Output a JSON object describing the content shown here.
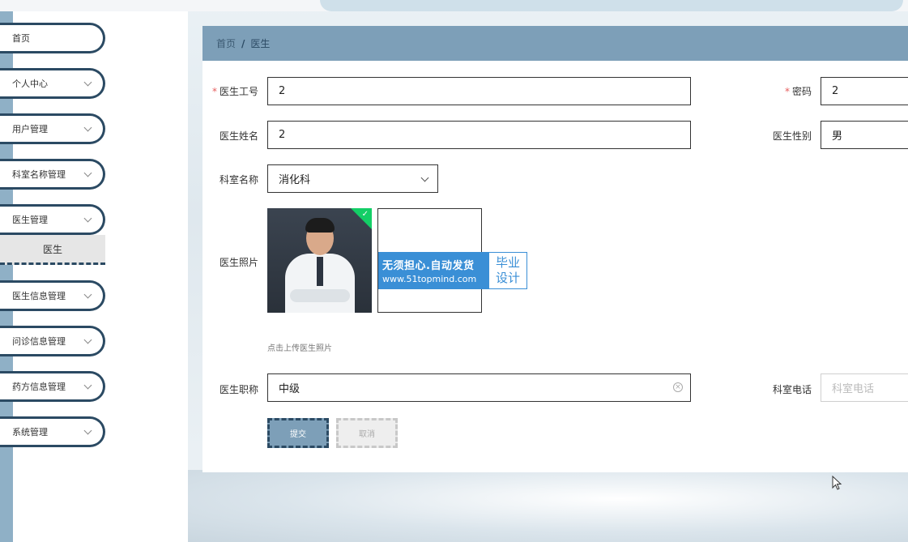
{
  "sidebar": {
    "items": [
      {
        "label": "首页",
        "has_arrow": false
      },
      {
        "label": "个人中心",
        "has_arrow": true
      },
      {
        "label": "用户管理",
        "has_arrow": true
      },
      {
        "label": "科室名称管理",
        "has_arrow": true
      },
      {
        "label": "医生管理",
        "has_arrow": true
      },
      {
        "label": "医生信息管理",
        "has_arrow": true
      },
      {
        "label": "问诊信息管理",
        "has_arrow": true
      },
      {
        "label": "药方信息管理",
        "has_arrow": true
      },
      {
        "label": "系统管理",
        "has_arrow": true
      }
    ],
    "active_sub": "医生"
  },
  "breadcrumb": {
    "home": "首页",
    "separator": "/",
    "current": "医生"
  },
  "form": {
    "doctor_id_label": "医生工号",
    "doctor_id_value": "2",
    "password_label": "密码",
    "password_value": "2",
    "doctor_name_label": "医生姓名",
    "doctor_name_value": "2",
    "gender_label": "医生性别",
    "gender_value": "男",
    "department_label": "科室名称",
    "department_value": "消化科",
    "photo_label": "医生照片",
    "photo_tip": "点击上传医生照片",
    "title_label": "医生职称",
    "title_value": "中级",
    "phone_label": "科室电话",
    "phone_placeholder": "科室电话",
    "required_mark": "*"
  },
  "buttons": {
    "submit": "提交",
    "cancel": "取消"
  },
  "watermark": {
    "line1": "无须担心.自动发货",
    "line2": "www.51topmind.com",
    "right_line1": "毕业",
    "right_line2": "设计"
  },
  "colors": {
    "accent": "#7d9fb8",
    "dark": "#2b4a63",
    "required": "#e65d5d",
    "success": "#13ce66"
  }
}
